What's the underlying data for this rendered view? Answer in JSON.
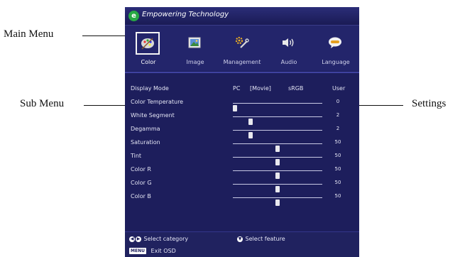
{
  "callouts": {
    "main_menu": "Main Menu",
    "sub_menu": "Sub Menu",
    "settings": "Settings"
  },
  "osd": {
    "brand": "Empowering Technology",
    "tabs": [
      {
        "label": "Color",
        "icon": "palette-icon",
        "active": true
      },
      {
        "label": "Image",
        "icon": "picture-icon",
        "active": false
      },
      {
        "label": "Management",
        "icon": "tools-icon",
        "active": false
      },
      {
        "label": "Audio",
        "icon": "speaker-icon",
        "active": false
      },
      {
        "label": "Language",
        "icon": "speech-bubble-icon",
        "active": false
      }
    ],
    "display_mode": {
      "label": "Display Mode",
      "options": [
        "PC",
        "[Movie]",
        "sRGB",
        "User"
      ]
    },
    "items": [
      {
        "label": "Color Temperature",
        "value": "0",
        "level": 0.02
      },
      {
        "label": "White Segment",
        "value": "2",
        "level": 0.2
      },
      {
        "label": "Degamma",
        "value": "2",
        "level": 0.2
      },
      {
        "label": "Saturation",
        "value": "50",
        "level": 0.5
      },
      {
        "label": "Tint",
        "value": "50",
        "level": 0.5
      },
      {
        "label": "Color R",
        "value": "50",
        "level": 0.5
      },
      {
        "label": "Color G",
        "value": "50",
        "level": 0.5
      },
      {
        "label": "Color B",
        "value": "50",
        "level": 0.5
      }
    ],
    "footer": {
      "select_category": "Select category",
      "select_feature": "Select feature",
      "menu_key": "MENU",
      "exit": "Exit OSD"
    }
  }
}
